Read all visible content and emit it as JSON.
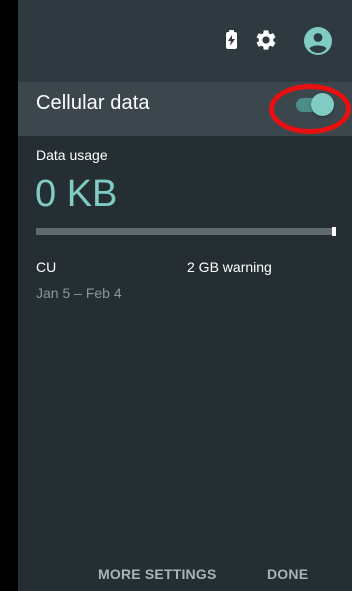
{
  "status_icons": [
    "battery-charging-icon",
    "gear-icon",
    "account-circle-icon"
  ],
  "header": {
    "title": "Cellular data",
    "toggle_on": true
  },
  "usage": {
    "label": "Data usage",
    "value": "0 KB",
    "fraction_used": 0,
    "carrier": "CU",
    "warning": "2 GB warning",
    "period": "Jan 5 – Feb 4"
  },
  "actions": {
    "more_settings": "MORE SETTINGS",
    "done": "DONE"
  },
  "colors": {
    "accent": "#80cbc4",
    "panel": "#252f33",
    "header": "#3b474d",
    "highlight": "#e81010"
  }
}
